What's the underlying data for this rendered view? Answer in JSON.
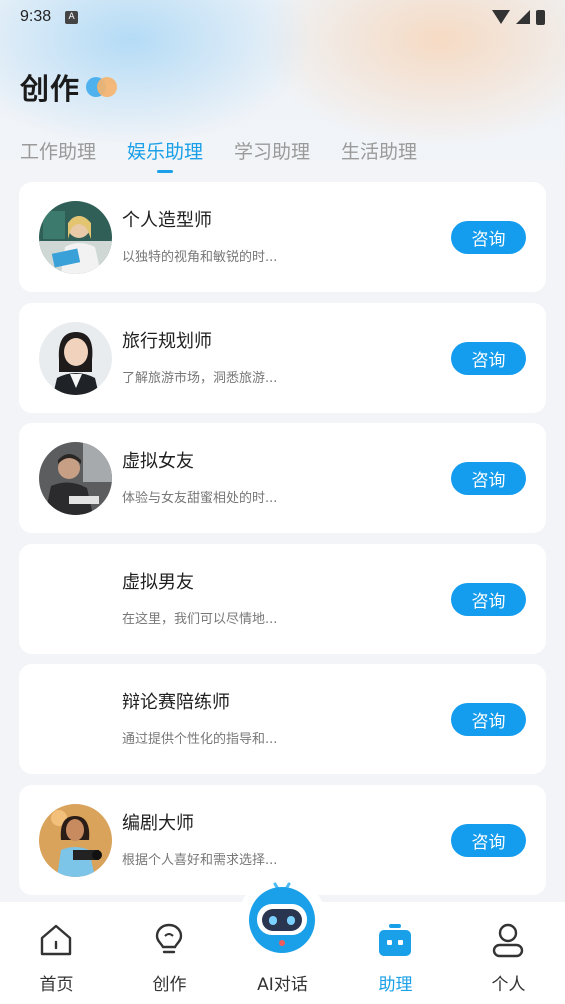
{
  "status_bar": {
    "time": "9:38",
    "notification_icon": "A"
  },
  "header": {
    "title": "创作"
  },
  "tabs": [
    {
      "label": "工作助理",
      "active": false
    },
    {
      "label": "娱乐助理",
      "active": true
    },
    {
      "label": "学习助理",
      "active": false
    },
    {
      "label": "生活助理",
      "active": false
    }
  ],
  "assistants": [
    {
      "name": "个人造型师",
      "desc": "以独特的视角和敏锐的时...",
      "button": "咨询",
      "has_avatar": true
    },
    {
      "name": "旅行规划师",
      "desc": "了解旅游市场，洞悉旅游...",
      "button": "咨询",
      "has_avatar": true
    },
    {
      "name": "虚拟女友",
      "desc": "体验与女友甜蜜相处的时...",
      "button": "咨询",
      "has_avatar": true
    },
    {
      "name": "虚拟男友",
      "desc": "在这里，我们可以尽情地...",
      "button": "咨询",
      "has_avatar": false
    },
    {
      "name": "辩论赛陪练师",
      "desc": "通过提供个性化的指导和...",
      "button": "咨询",
      "has_avatar": false
    },
    {
      "name": "编剧大师",
      "desc": "根据个人喜好和需求选择...",
      "button": "咨询",
      "has_avatar": true
    }
  ],
  "tabbar": [
    {
      "label": "首页",
      "icon": "home-icon",
      "active": false
    },
    {
      "label": "创作",
      "icon": "lightbulb-icon",
      "active": false
    },
    {
      "label": "AI对话",
      "icon": "robot-icon",
      "active": false
    },
    {
      "label": "助理",
      "icon": "assistant-icon",
      "active": true
    },
    {
      "label": "个人",
      "icon": "person-icon",
      "active": false
    }
  ],
  "colors": {
    "accent": "#1aa0e8",
    "button": "#149cee"
  }
}
